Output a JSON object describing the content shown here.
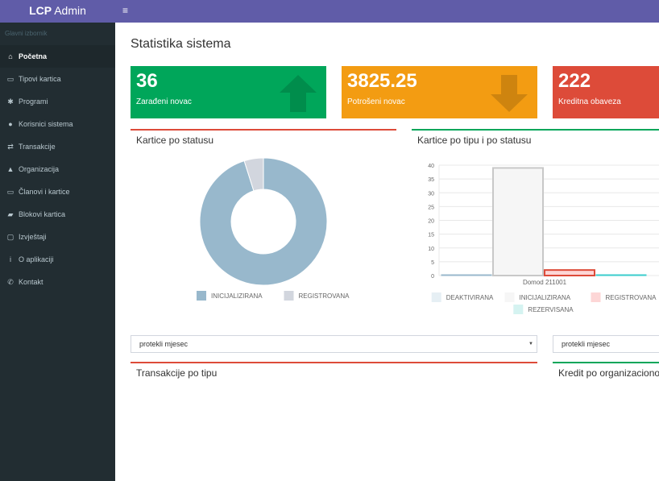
{
  "app": {
    "brand_bold": "LCP",
    "brand_rest": " Admin"
  },
  "sidebar": {
    "header": "Glavni izbornik",
    "items": [
      {
        "label": "Početna",
        "icon": "home-icon",
        "glyph": "⌂"
      },
      {
        "label": "Tipovi kartica",
        "icon": "card-icon",
        "glyph": "▭"
      },
      {
        "label": "Programi",
        "icon": "asterisk-icon",
        "glyph": "✱"
      },
      {
        "label": "Korisnici sistema",
        "icon": "user-icon",
        "glyph": "●"
      },
      {
        "label": "Transakcije",
        "icon": "exchange-icon",
        "glyph": "⇄"
      },
      {
        "label": "Organizacija",
        "icon": "tree-icon",
        "glyph": "▲"
      },
      {
        "label": "Članovi i kartice",
        "icon": "card-icon",
        "glyph": "▭"
      },
      {
        "label": "Blokovi kartica",
        "icon": "book-icon",
        "glyph": "▰"
      },
      {
        "label": "Izvještaji",
        "icon": "report-icon",
        "glyph": "▢"
      },
      {
        "label": "O aplikaciji",
        "icon": "info-icon",
        "glyph": "i"
      },
      {
        "label": "Kontakt",
        "icon": "phone-icon",
        "glyph": "✆"
      }
    ]
  },
  "topbar": {
    "menu_glyph": "≡"
  },
  "page": {
    "title": "Statistika sistema"
  },
  "stats": [
    {
      "value": "36",
      "label": "Zarađeni novac",
      "color": "#00a65a",
      "icon": "arrow-up-icon"
    },
    {
      "value": "3825.25",
      "label": "Potrošeni novac",
      "color": "#f39c12",
      "icon": "arrow-down-icon"
    },
    {
      "value": "222",
      "label": "Kreditna obaveza",
      "color": "#dd4b39",
      "icon": "arrow-icon"
    }
  ],
  "panels": {
    "status_title": "Kartice po statusu",
    "type_title": "Kartice po tipu i po statusu",
    "trans_title": "Transakcije po tipu",
    "credit_title": "Kredit po organizacionom"
  },
  "filters": {
    "left_value": "protekli mjesec",
    "right_value": "protekli mjesec"
  },
  "chart_data": [
    {
      "type": "pie",
      "labels": [
        "INICIJALIZIRANA",
        "REGISTROVANA"
      ],
      "values": [
        39,
        2
      ],
      "colors": [
        "#98b8cc",
        "#d2d6de"
      ],
      "donut": true,
      "legend": "bottom"
    },
    {
      "type": "bar",
      "categories": [
        "Domod 211001"
      ],
      "ylim": [
        0,
        40
      ],
      "yticks": [
        "40",
        "35",
        "30",
        "25",
        "20",
        "15",
        "10",
        "5",
        "0"
      ],
      "grid": true,
      "legend": "bottom",
      "series": [
        {
          "name": "DEAKTIVIRANA",
          "values": [
            0
          ],
          "fill": "#e6eff4",
          "stroke": "#98b8cc"
        },
        {
          "name": "INICIJALIZIRANA",
          "values": [
            39
          ],
          "fill": "#f6f6f6",
          "stroke": "#c8c8c8"
        },
        {
          "name": "REGISTROVANA",
          "values": [
            2
          ],
          "fill": "#fdd6d6",
          "stroke": "#dd4b39"
        },
        {
          "name": "REZERVISANA",
          "values": [
            0
          ],
          "fill": "#d5f3f1",
          "stroke": "#39cccc"
        }
      ]
    }
  ]
}
